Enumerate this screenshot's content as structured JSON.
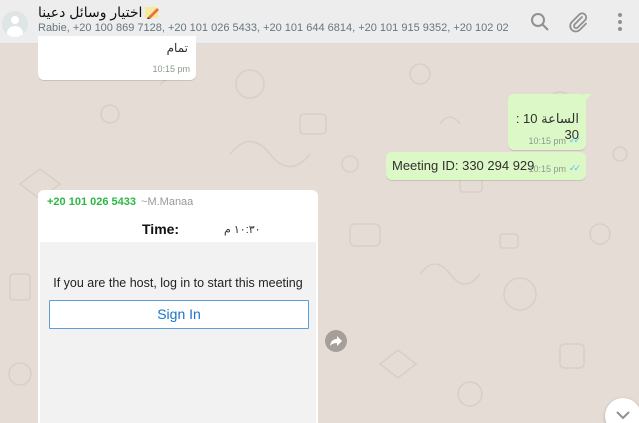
{
  "header": {
    "title": "اختيار وسائل دعينا",
    "participants": "Rabie, +20 100 869 7128, +20 101 026 5433, +20 101 644 6814, +20 101 915 9352, +20 102 02...",
    "icons": [
      "search-icon",
      "attach-icon",
      "menu-icon"
    ]
  },
  "messages": [
    {
      "type": "incoming",
      "text": "تمام",
      "time": "10:15 pm"
    },
    {
      "type": "outgoing",
      "text": "الساعة 10 : 30",
      "time": "10:15 pm",
      "status": "read"
    },
    {
      "type": "outgoing",
      "text": "Meeting ID: 330 294 929",
      "time": "10:15 pm",
      "status": "read"
    }
  ],
  "card": {
    "sender_number": "+20 101 026 5433",
    "sender_name": "~M.Manaa",
    "time_label": "Time:",
    "time_value": "١٠:٣٠ م",
    "host_text": "If you are the host, log in to start this meeting",
    "signin_label": "Sign In"
  },
  "colors": {
    "wallpaper": "#e5ddd5",
    "outgoing": "#dcf8c6",
    "incoming": "#ffffff",
    "read_ticks": "#4fc3f7",
    "sender": "#2db742",
    "link": "#1a73c8"
  }
}
